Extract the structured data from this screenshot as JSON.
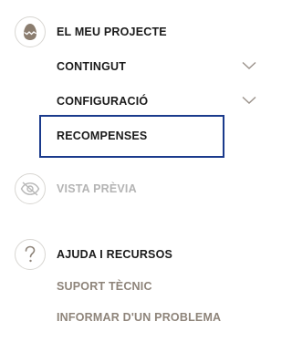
{
  "project": {
    "title": "EL MEU PROJECTE",
    "icon": "egg-icon",
    "items": [
      {
        "label": "CONTINGUT",
        "expandable": true
      },
      {
        "label": "CONFIGURACIÓ",
        "expandable": true
      },
      {
        "label": "RECOMPENSES",
        "expandable": false,
        "focused": true
      }
    ]
  },
  "preview": {
    "label": "VISTA PRÈVIA",
    "icon": "eye-slash-icon",
    "disabled": true
  },
  "help": {
    "title": "AJUDA I RECURSOS",
    "icon": "question-icon",
    "items": [
      {
        "label": "SUPORT TÈCNIC"
      },
      {
        "label": "INFORMAR D'UN PROBLEMA"
      }
    ]
  },
  "colors": {
    "text": "#1b1b1b",
    "muted": "#8e847a",
    "disabled": "#b4b4b4",
    "focus_border": "#1a3a8c",
    "egg": "#8b7d6f"
  }
}
